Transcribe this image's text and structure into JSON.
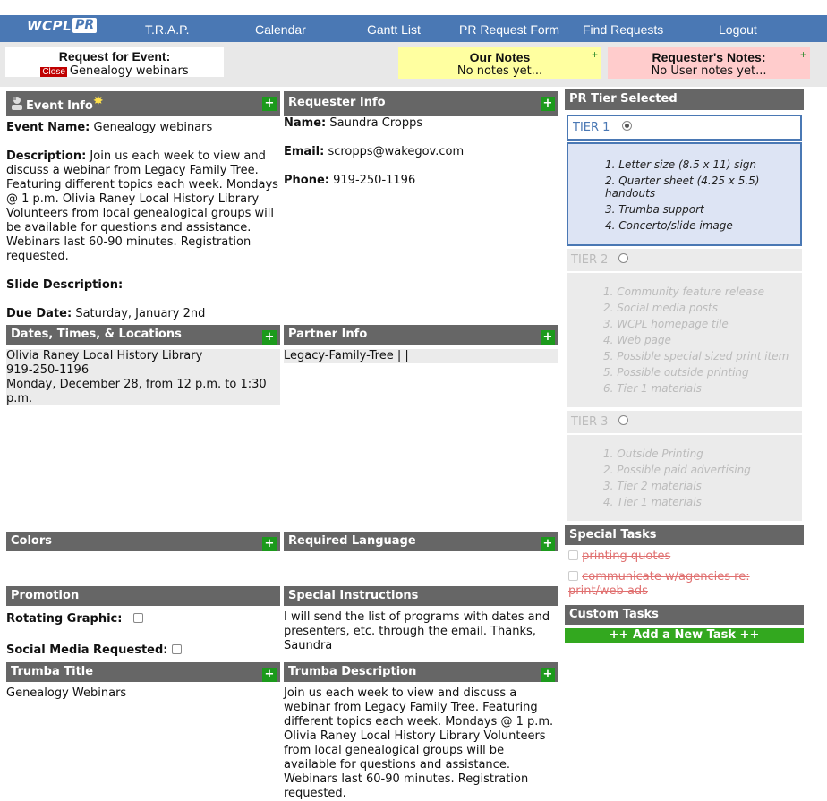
{
  "nav": {
    "logo_wcpl": "WCPL",
    "logo_pr": "PR",
    "links": [
      "T.R.A.P.",
      "Calendar",
      "Gantt List",
      "PR Request Form",
      "Find Requests",
      "Logout"
    ]
  },
  "header": {
    "request_title": "Request for Event:",
    "close_label": "Close",
    "request_name": "Genealogy webinars",
    "our_notes_title": "Our Notes",
    "our_notes_text": "No notes yet...",
    "req_notes_title": "Requester's Notes:",
    "req_notes_text": "No User notes yet..."
  },
  "event_info": {
    "title": "Event Info",
    "name_label": "Event Name:",
    "name_value": "Genealogy webinars",
    "desc_label": "Description:",
    "desc_value": "Join us each week to view and discuss a webinar from Legacy Family Tree. Featuring different topics each week. Mondays @ 1 p.m. Olivia Raney Local History Library Volunteers from local genealogical groups will be available for questions and assistance. Webinars last 60-90 minutes. Registration requested.",
    "slide_label": "Slide Description:",
    "due_label": "Due Date:",
    "due_value": "Saturday, January 2nd"
  },
  "requester_info": {
    "title": "Requester Info",
    "name_label": "Name:",
    "name_value": "Saundra Cropps",
    "email_label": "Email:",
    "email_value": "scropps@wakegov.com",
    "phone_label": "Phone:",
    "phone_value": "919-250-1196"
  },
  "dates": {
    "title": "Dates, Times, & Locations",
    "location": "Olivia Raney Local History Library",
    "phone": "919-250-1196",
    "datetime": "Monday, December 28, from 12 p.m. to 1:30 p.m."
  },
  "partner": {
    "title": "Partner Info",
    "value": "Legacy-Family-Tree | |"
  },
  "colors": {
    "title": "Colors"
  },
  "required_language": {
    "title": "Required Language"
  },
  "promotion": {
    "title": "Promotion",
    "rotating_label": "Rotating Graphic:",
    "social_label": "Social Media Requested:"
  },
  "special_instructions": {
    "title": "Special Instructions",
    "value": "I will send the list of programs with dates and presenters, etc. through the email. Thanks, Saundra"
  },
  "trumba_title": {
    "title": "Trumba Title",
    "value": "Genealogy Webinars"
  },
  "trumba_description": {
    "title": "Trumba Description",
    "value": "Join us each week to view and discuss a webinar from Legacy Family Tree. Featuring different topics each week. Mondays @ 1 p.m. Olivia Raney Local History Library Volunteers from local genealogical groups will be available for questions and assistance. Webinars last 60-90 minutes. Registration requested."
  },
  "tiers": {
    "title": "PR Tier Selected",
    "tier1": {
      "label": "TIER 1",
      "items": [
        "1. Letter size (8.5 x 11) sign",
        "2. Quarter sheet (4.25 x 5.5) handouts",
        "3. Trumba support",
        "4. Concerto/slide image"
      ]
    },
    "tier2": {
      "label": "TIER 2",
      "items": [
        "1. Community feature release",
        "2. Social media posts",
        "3. WCPL homepage tile",
        "4. Web page",
        "5. Possible special sized print item",
        "5. Possible outside printing",
        "6. Tier 1 materials"
      ]
    },
    "tier3": {
      "label": "TIER 3",
      "items": [
        "1. Outside Printing",
        "2. Possible paid advertising",
        "3. Tier 2 materials",
        "4. Tier 1 materials"
      ]
    }
  },
  "special_tasks": {
    "title": "Special Tasks",
    "items": [
      "printing quotes",
      "communicate w/agencies re: print/web ads"
    ]
  },
  "custom_tasks": {
    "title": "Custom Tasks",
    "add_label": "++ Add a New Task ++"
  },
  "colors_theme": {
    "nav_bg": "#4a78b4",
    "bar_bg": "#666666",
    "plus_green": "#1c9a1c",
    "tier1_bg": "#dde4f4",
    "tier1_border": "#4a78b4",
    "inactive_bg": "#ebebeb"
  }
}
